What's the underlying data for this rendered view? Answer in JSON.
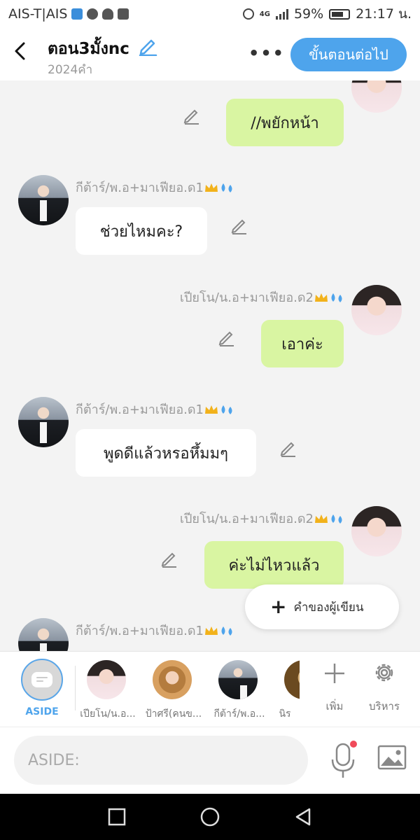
{
  "status_bar": {
    "carrier": "AIS-T|AIS",
    "network": "4G",
    "battery": "59%",
    "time": "21:17 น."
  },
  "header": {
    "title": "ตอน3มั้งnc",
    "word_count": "2024คำ",
    "next_label": "ขั้นตอนต่อไป"
  },
  "messages": [
    {
      "side": "right",
      "text": "//พยักหน้า"
    },
    {
      "side": "left",
      "name": "กีต้าร์/พ.อ+มาเฟียอ.ด1",
      "text": "ช่วยไหมคะ?"
    },
    {
      "side": "right",
      "name": "เปียโน/น.อ+มาเฟียอ.ด2",
      "text": "เอาค่ะ"
    },
    {
      "side": "left",
      "name": "กีต้าร์/พ.อ+มาเฟียอ.ด1",
      "text": "พูดดีแล้วหรอหึ้มมๆ"
    },
    {
      "side": "right",
      "name": "เปียโน/น.อ+มาเฟียอ.ด2",
      "text": "ค่ะไม่ไหวแล้ว"
    },
    {
      "side": "left",
      "name": "กีต้าร์/พ.อ+มาเฟียอ.ด1"
    }
  ],
  "fab": {
    "label": "คำของผู้เขียน"
  },
  "characters": {
    "aside_label": "ASIDE",
    "items": [
      {
        "label": "เปียโน/น.อ..."
      },
      {
        "label": "ป้าศรี(คนข..."
      },
      {
        "label": "กีต้าร์/พ.อ..."
      },
      {
        "label": "นิร"
      }
    ],
    "add_label": "เพิ่ม",
    "manage_label": "บริหาร"
  },
  "input": {
    "placeholder": "ASIDE:"
  },
  "colors": {
    "accent": "#4ea4ec",
    "bubble_right": "#d9f5a2",
    "bubble_left": "#ffffff"
  }
}
